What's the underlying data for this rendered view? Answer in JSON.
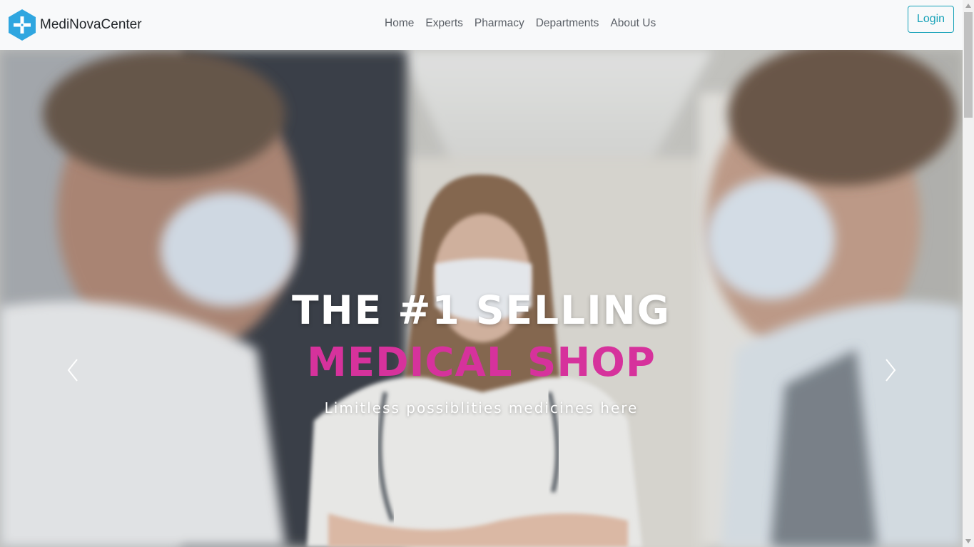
{
  "brand": {
    "name": "MediNovaCenter",
    "logo_icon": "medical-cross-hexagon-icon",
    "logo_color": "#2fa6e0"
  },
  "nav": {
    "items": [
      {
        "label": "Home"
      },
      {
        "label": "Experts"
      },
      {
        "label": "Pharmacy"
      },
      {
        "label": "Departments"
      },
      {
        "label": "About Us"
      }
    ]
  },
  "login": {
    "label": "Login",
    "color": "#17a2b8"
  },
  "hero": {
    "title_line1": "THE #1 SELLING",
    "title_line2": "MEDICAL SHOP",
    "subtitle": "Limitless possiblities medicines here",
    "accent_color": "#d6329c",
    "prev_icon": "chevron-left-icon",
    "next_icon": "chevron-right-icon"
  }
}
